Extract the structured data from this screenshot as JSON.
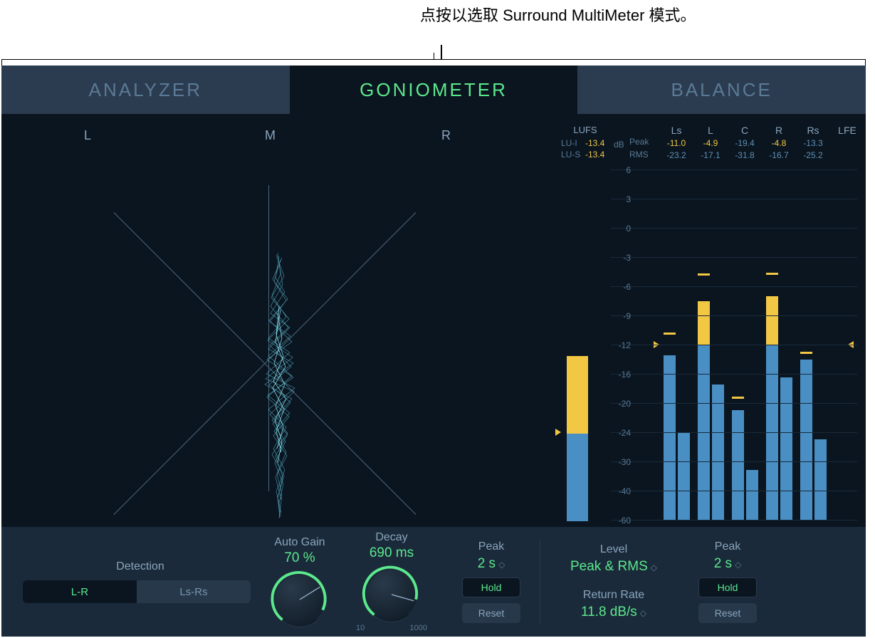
{
  "annotation": "点按以选取 Surround MultiMeter 模式。",
  "tabs": {
    "analyzer": "ANALYZER",
    "goniometer": "GONIOMETER",
    "balance": "BALANCE"
  },
  "gonio_labels": {
    "l": "L",
    "m": "M",
    "r": "R"
  },
  "lufs": {
    "title": "LUFS",
    "lui_label": "LU-I",
    "lui_value": "-13.4",
    "lus_label": "LU-S",
    "lus_value": "-13.4",
    "db_label": "dB"
  },
  "meter_labels": {
    "peak": "Peak",
    "rms": "RMS"
  },
  "channels": [
    "Ls",
    "L",
    "C",
    "R",
    "Rs",
    "LFE"
  ],
  "peak_values": [
    "-11.0",
    "-4.9",
    "-19.4",
    "-4.8",
    "-13.3",
    ""
  ],
  "rms_values": [
    "-23.2",
    "-17.1",
    "-31.8",
    "-16.7",
    "-25.2",
    ""
  ],
  "scale_ticks": [
    "6",
    "3",
    "0",
    "-3",
    "-6",
    "-9",
    "-12",
    "-16",
    "-20",
    "-24",
    "-30",
    "-40",
    "-60"
  ],
  "detection": {
    "label": "Detection",
    "lr": "L-R",
    "lsrs": "Ls-Rs"
  },
  "auto_gain": {
    "label": "Auto Gain",
    "value": "70 %"
  },
  "decay": {
    "label": "Decay",
    "value": "690 ms",
    "min": "10",
    "max": "1000"
  },
  "peak_control": {
    "label": "Peak",
    "value": "2 s",
    "hold": "Hold",
    "reset": "Reset"
  },
  "level": {
    "label": "Level",
    "value": "Peak & RMS"
  },
  "return_rate": {
    "label": "Return Rate",
    "value": "11.8 dB/s"
  },
  "peak_control2": {
    "label": "Peak",
    "value": "2 s",
    "hold": "Hold",
    "reset": "Reset"
  },
  "chart_data": {
    "type": "bar",
    "title": "Channel Level Meters",
    "ylabel": "dB",
    "ylim": [
      -60,
      6
    ],
    "lufs_bar": {
      "blue_top": -24,
      "yellow_top": -13.4
    },
    "series": [
      {
        "name": "Peak",
        "categories": [
          "Ls",
          "L",
          "C",
          "R",
          "Rs",
          "LFE"
        ],
        "values": [
          -13.5,
          -7.5,
          -21,
          -7,
          -14,
          null
        ],
        "hold": [
          -11.0,
          -4.9,
          -19.4,
          -4.8,
          -13.3,
          null
        ]
      },
      {
        "name": "RMS",
        "categories": [
          "Ls",
          "L",
          "C",
          "R",
          "Rs",
          "LFE"
        ],
        "values": [
          -24,
          -17.5,
          -33,
          -16.5,
          -25.5,
          null
        ]
      }
    ]
  }
}
